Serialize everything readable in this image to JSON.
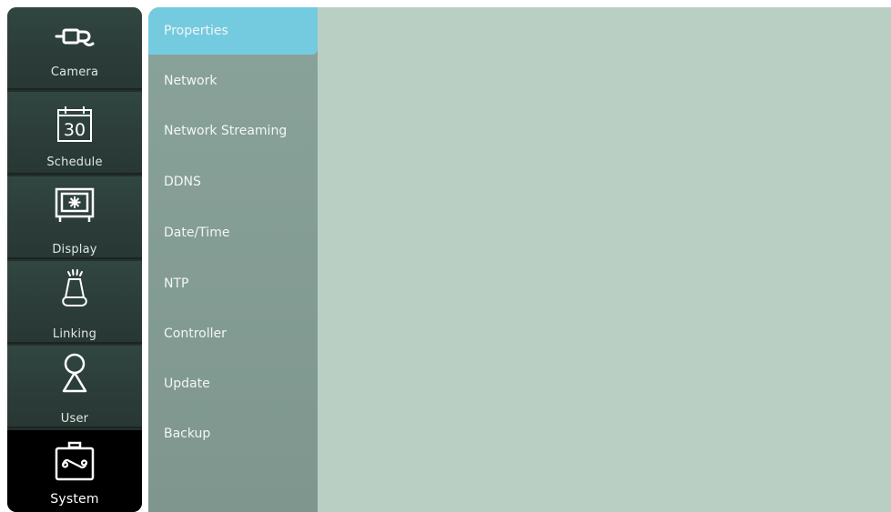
{
  "left_nav": {
    "items": [
      {
        "label": "Camera",
        "icon": "camera-plug-icon"
      },
      {
        "label": "Schedule",
        "icon": "calendar-icon",
        "icon_text": "30"
      },
      {
        "label": "Display",
        "icon": "display-icon"
      },
      {
        "label": "Linking",
        "icon": "alarm-light-icon"
      },
      {
        "label": "User",
        "icon": "user-icon"
      },
      {
        "label": "System",
        "icon": "toolbox-icon"
      }
    ],
    "active": "System"
  },
  "sub_menu": {
    "items": [
      {
        "label": "Properties"
      },
      {
        "label": "Network"
      },
      {
        "label": "Network Streaming"
      },
      {
        "label": "DDNS"
      },
      {
        "label": "Date/Time"
      },
      {
        "label": "NTP"
      },
      {
        "label": "Controller"
      },
      {
        "label": "Update"
      },
      {
        "label": "Backup"
      }
    ],
    "active": "Properties"
  },
  "colors": {
    "sidebar_bg": "#2c3d39",
    "active_category": "#000000",
    "submenu_bg": "#8aa39a",
    "submenu_active": "#74cbe0",
    "content_bg": "#bacfc4"
  }
}
